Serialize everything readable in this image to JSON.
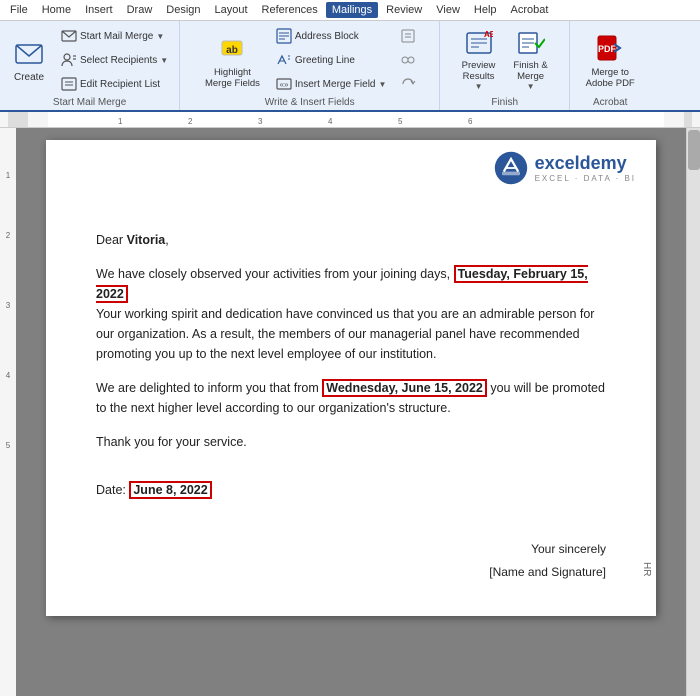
{
  "menubar": {
    "items": [
      "File",
      "Home",
      "Insert",
      "Draw",
      "Design",
      "Layout",
      "References",
      "Mailings",
      "Review",
      "View",
      "Help",
      "Acrobat"
    ],
    "active": "Mailings"
  },
  "ribbon": {
    "groups": [
      {
        "label": "Start Mail Merge",
        "buttons_large": [
          {
            "id": "create",
            "label": "Create",
            "icon": "envelope-icon"
          }
        ],
        "buttons_small": [
          {
            "id": "start-mail-merge",
            "label": "Start Mail Merge",
            "dropdown": true
          },
          {
            "id": "select-recipients",
            "label": "Select Recipients",
            "dropdown": true
          },
          {
            "id": "edit-recipient-list",
            "label": "Edit Recipient List"
          }
        ]
      },
      {
        "label": "Write & Insert Fields",
        "buttons_large": [
          {
            "id": "highlight-merge-fields",
            "label": "Highlight\nMerge Fields",
            "icon": "highlight-icon"
          }
        ],
        "buttons_small": [
          {
            "id": "address-block",
            "label": "Address Block",
            "icon": "address-icon"
          },
          {
            "id": "greeting-line",
            "label": "Greeting Line",
            "icon": "greeting-icon"
          },
          {
            "id": "insert-merge-field",
            "label": "Insert Merge Field",
            "dropdown": true,
            "icon": "field-icon"
          },
          {
            "id": "rules",
            "label": "",
            "icon": "rules-icon"
          },
          {
            "id": "match-fields",
            "label": "",
            "icon": "match-icon"
          },
          {
            "id": "update-labels",
            "label": "",
            "icon": "update-icon"
          }
        ]
      },
      {
        "label": "",
        "buttons_large": [
          {
            "id": "preview-results",
            "label": "Preview\nResults",
            "dropdown": true,
            "icon": "preview-icon"
          },
          {
            "id": "finish-merge",
            "label": "Finish &\nMerge",
            "dropdown": true,
            "icon": "finish-icon"
          }
        ]
      },
      {
        "label": "Finish",
        "buttons_large": []
      },
      {
        "label": "Acrobat",
        "buttons_large": [
          {
            "id": "merge-to-pdf",
            "label": "Merge to\nAdobe PDF",
            "icon": "pdf-icon"
          }
        ]
      }
    ]
  },
  "document": {
    "greeting": "Dear ",
    "name": "Vitoria",
    "para1_start": "We have closely observed your activities from your joining days, ",
    "date1": "Tuesday, February 15, 2022",
    "para1_end": "Your working spirit and dedication have convinced us that you are an admirable person for our organization. As a result, the members of our managerial panel have recommended promoting you up to the next level employee of our institution.",
    "para2_start": "We are delighted to inform you that from ",
    "date2": "Wednesday, June 15, 2022",
    "para2_end": " you will be promoted to the next higher level according to our organization's structure.",
    "thank_you": "Thank you for your service.",
    "date_label": "Date: ",
    "date3": "June 8, 2022",
    "closing": "Your sincerely",
    "signature": "[Name and Signature]",
    "hr_label": "HR"
  },
  "logo": {
    "name": "exceldemy",
    "text": "exceldemy",
    "sub": "EXCEL · DATA · BI"
  }
}
